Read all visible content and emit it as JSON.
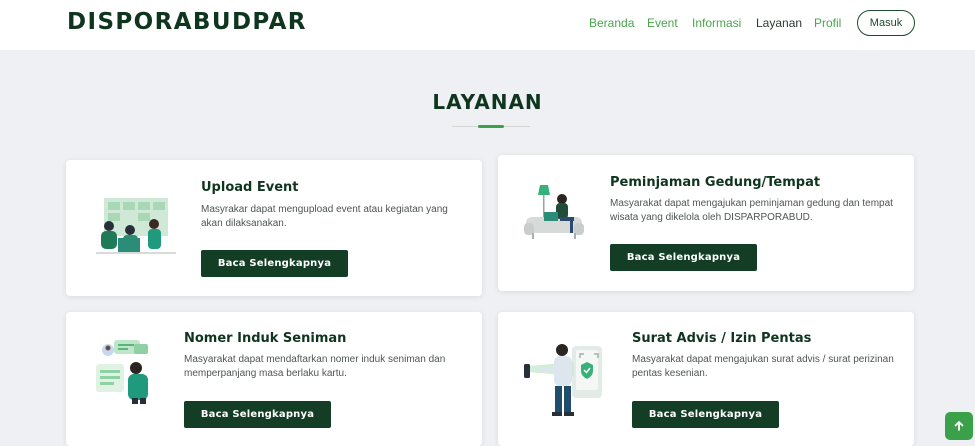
{
  "header": {
    "brand": "DISPORABUDPAR",
    "nav": [
      {
        "label": "Beranda",
        "active": false
      },
      {
        "label": "Event",
        "active": false
      },
      {
        "label": "Informasi",
        "active": false
      },
      {
        "label": "Layanan",
        "active": true
      },
      {
        "label": "Profil",
        "active": false
      }
    ],
    "login_label": "Masuk"
  },
  "section": {
    "title": "LAYANAN"
  },
  "cards": [
    {
      "title": "Upload Event",
      "description": "Masyrakar dapat mengupload event atau kegiatan yang akan dilaksanakan.",
      "button": "Baca Selengkapnya",
      "illustration": "team-meeting-illustration"
    },
    {
      "title": "Peminjaman Gedung/Tempat",
      "description": "Masyarakat dapat mengajukan peminjaman gedung dan tempat wisata yang dikelola oleh DISPARPORABUD.",
      "button": "Baca Selengkapnya",
      "illustration": "sofa-laptop-illustration"
    },
    {
      "title": "Nomer Induk Seniman",
      "description": "Masyarakat dapat mendaftarkan nomer induk seniman dan memperpanjang masa berlaku kartu.",
      "button": "Baca Selengkapnya",
      "illustration": "id-card-illustration"
    },
    {
      "title": "Surat Advis / Izin Pentas",
      "description": "Masyarakat dapat mengajukan surat advis / surat perizinan pentas kesenian.",
      "button": "Baca Selengkapnya",
      "illustration": "phone-verification-illustration"
    }
  ],
  "colors": {
    "brand_dark": "#10351f",
    "accent_green": "#3aa14a",
    "button_green": "#133d25",
    "page_bg": "#eef0f3"
  },
  "icons": {
    "scroll_top": "arrow-up-icon"
  }
}
